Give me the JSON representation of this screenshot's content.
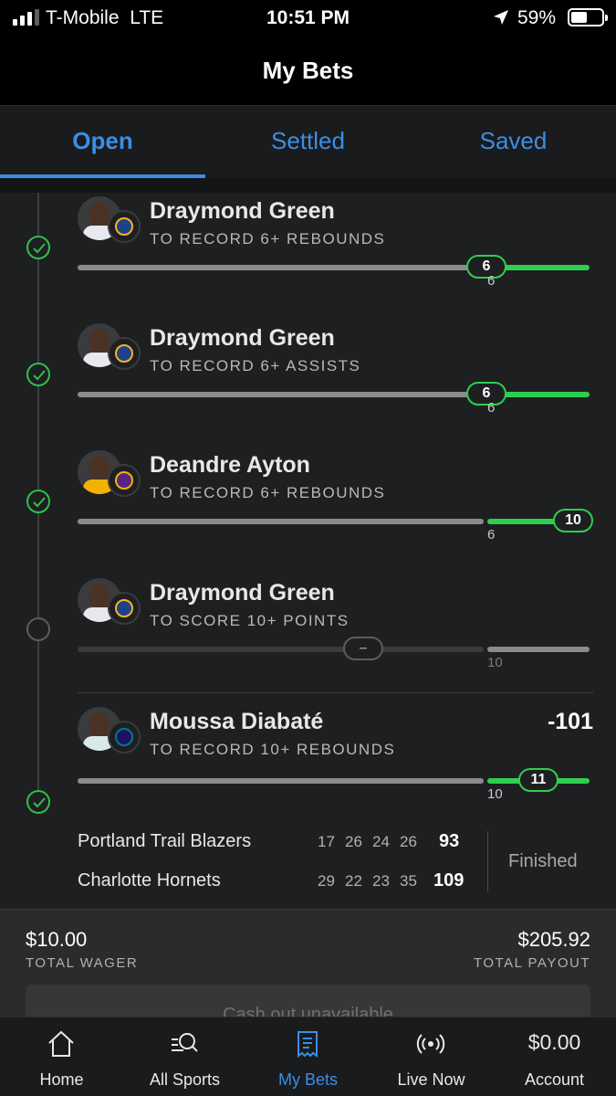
{
  "status_bar": {
    "carrier": "T-Mobile",
    "network": "LTE",
    "time": "10:51 PM",
    "battery": "59%"
  },
  "header": {
    "title": "My Bets"
  },
  "tabs": [
    {
      "label": "Open",
      "active": true
    },
    {
      "label": "Settled",
      "active": false
    },
    {
      "label": "Saved",
      "active": false
    }
  ],
  "legs": [
    {
      "player": "Draymond Green",
      "team_logo": "warriors-logo",
      "market": "TO RECORD 6+ REBOUNDS",
      "line": "6",
      "current": "6",
      "status": "won"
    },
    {
      "player": "Draymond Green",
      "team_logo": "warriors-logo",
      "market": "TO RECORD 6+ ASSISTS",
      "line": "6",
      "current": "6",
      "status": "won"
    },
    {
      "player": "Deandre Ayton",
      "team_logo": "lakers-logo",
      "market": "TO RECORD 6+ REBOUNDS",
      "line": "6",
      "current": "10",
      "status": "won"
    },
    {
      "player": "Draymond Green",
      "team_logo": "warriors-logo",
      "market": "TO SCORE 10+ POINTS",
      "line": "10",
      "current": "–",
      "status": "pending"
    },
    {
      "player": "Moussa Diabaté",
      "team_logo": "hornets-logo",
      "market": "TO RECORD 10+ REBOUNDS",
      "line": "10",
      "current": "11",
      "status": "won",
      "odds": "-101"
    }
  ],
  "game": {
    "teams": [
      {
        "name": "Portland Trail Blazers",
        "quarters": [
          "17",
          "26",
          "24",
          "26"
        ],
        "total": "93"
      },
      {
        "name": "Charlotte Hornets",
        "quarters": [
          "29",
          "22",
          "23",
          "35"
        ],
        "total": "109"
      }
    ],
    "status": "Finished"
  },
  "summary": {
    "wager": "$10.00",
    "wager_label": "TOTAL WAGER",
    "payout": "$205.92",
    "payout_label": "TOTAL PAYOUT",
    "cashout": "Cash out unavailable"
  },
  "nav": {
    "items": [
      {
        "label": "Home",
        "icon": "home-icon"
      },
      {
        "label": "All Sports",
        "icon": "search-sports-icon"
      },
      {
        "label": "My Bets",
        "icon": "bet-slip-icon",
        "active": true
      },
      {
        "label": "Live Now",
        "icon": "live-broadcast-icon"
      },
      {
        "label": "Account",
        "balance": "$0.00"
      }
    ]
  },
  "colors": {
    "accent": "#3a8ee6",
    "success": "#2fce4f",
    "background": "#1e1f21"
  }
}
